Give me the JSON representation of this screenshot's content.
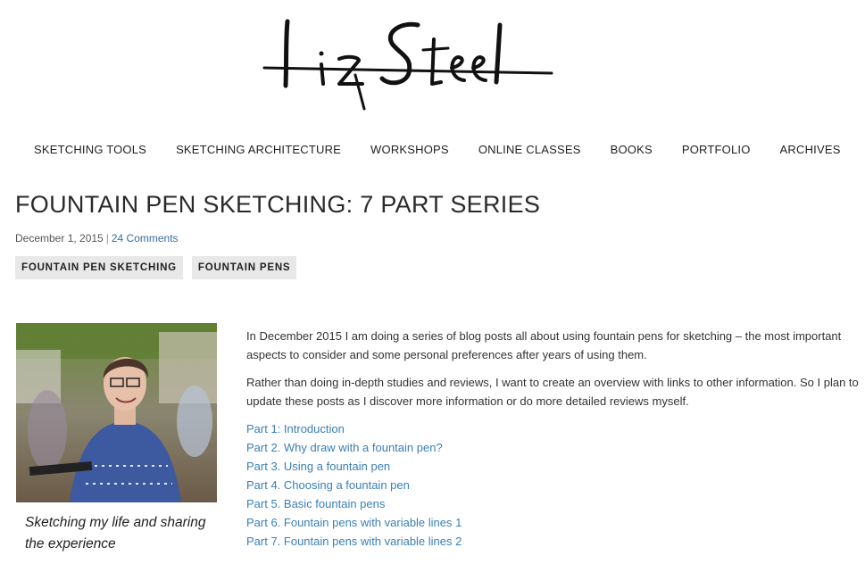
{
  "logo": {
    "text": "LizSteel"
  },
  "nav": {
    "items": [
      {
        "label": "SKETCHING TOOLS"
      },
      {
        "label": "SKETCHING ARCHITECTURE"
      },
      {
        "label": "WORKSHOPS"
      },
      {
        "label": "ONLINE CLASSES"
      },
      {
        "label": "BOOKS"
      },
      {
        "label": "PORTFOLIO"
      },
      {
        "label": "ARCHIVES"
      }
    ]
  },
  "post": {
    "title": "FOUNTAIN PEN SKETCHING: 7 PART SERIES",
    "date": "December 1, 2015",
    "separator": "|",
    "comments": "24 Comments",
    "tags": [
      "FOUNTAIN PEN SKETCHING",
      "FOUNTAIN PENS"
    ],
    "paragraphs": [
      "In December 2015 I am doing a series of blog posts all about using fountain pens for sketching – the most important aspects to consider and some personal preferences after years of using them.",
      "Rather than doing in-depth studies and reviews, I want to create an overview with links to other information. So I plan to update these posts as I discover more information or do more detailed reviews myself."
    ],
    "parts": [
      "Part 1: Introduction",
      "Part 2. Why draw with a fountain pen?",
      "Part 3. Using a fountain pen",
      "Part 4. Choosing a fountain pen",
      "Part 5. Basic fountain pens",
      "Part 6. Fountain pens with variable lines 1",
      "Part 7. Fountain pens with variable lines 2"
    ]
  },
  "sidebar": {
    "caption": "Sketching my life and sharing the experience"
  },
  "colors": {
    "link": "#3a7fb5",
    "tag_bg": "#e8e8e8"
  }
}
